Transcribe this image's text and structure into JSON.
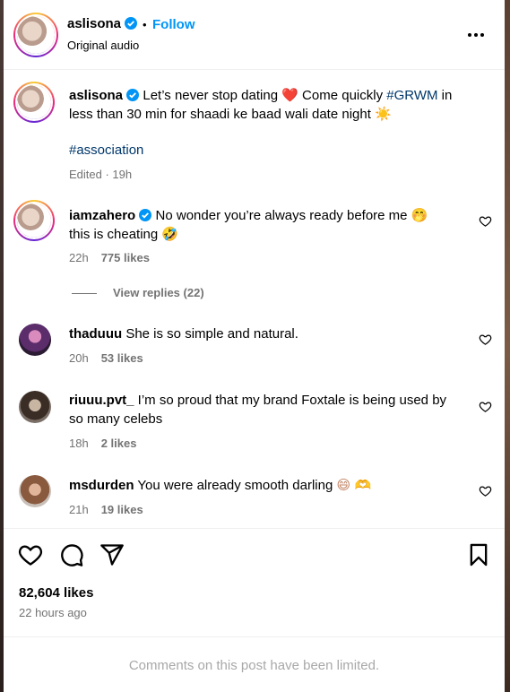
{
  "header": {
    "username": "aslisona",
    "separator": "•",
    "follow_label": "Follow",
    "subtitle": "Original audio",
    "more_icon": "more-horizontal-icon"
  },
  "caption": {
    "username": "aslisona",
    "text_before": " Let’s never stop dating ",
    "emoji_heart": "❤️",
    "text_mid": "  Come quickly ",
    "hashtag1": "#GRWM",
    "text_after": " in",
    "line2": "less than 30 min for shaadi ke baad wali date night ",
    "emoji_sun": "☀️",
    "hashtag2": "#association",
    "meta": "Edited · 19h"
  },
  "comments": [
    {
      "username": "iamzahero",
      "line1": " No wonder you’re always ready before me ",
      "emoji1": "🤭",
      "line2": "this is cheating ",
      "emoji2": "🤣",
      "time": "22h",
      "likes": "775 likes",
      "view_replies": "View replies (22)"
    },
    {
      "username": "thaduuu",
      "text": " She is so simple and natural.",
      "time": "20h",
      "likes": "53 likes"
    },
    {
      "username": "riuuu.pvt_",
      "line1": " I’m so proud that my brand Foxtale is being used by",
      "line2": "so many celebs",
      "time": "18h",
      "likes": "2 likes"
    },
    {
      "username": "msdurden",
      "text": " You were already smooth darling ",
      "emoji": "😄 🫶",
      "time": "21h",
      "likes": "19 likes"
    }
  ],
  "footer": {
    "likes": "82,604 likes",
    "time": "22 hours ago",
    "limited": "Comments on this post have been limited."
  },
  "colors": {
    "accent": "#0095f6",
    "hashtag": "#00376b",
    "muted": "#737373",
    "verified": "#0095f6"
  }
}
